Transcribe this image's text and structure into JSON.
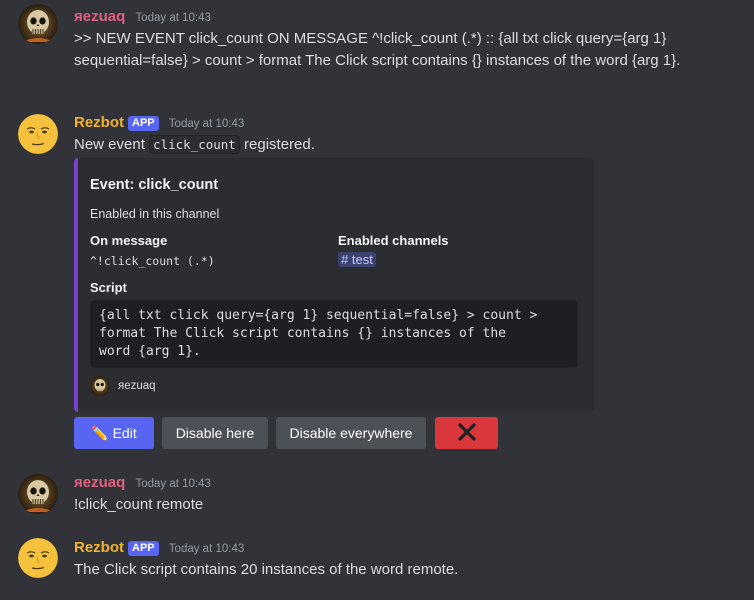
{
  "messages": [
    {
      "author": "яezuaq",
      "timestamp": "Today at 10:43",
      "text": ">> NEW EVENT click_count ON MESSAGE ^!click_count (.*) :: {all txt click query={arg 1} sequential=false} > count > format The Click script contains {} instances of the word {arg 1}."
    },
    {
      "author": "Rezbot",
      "app_tag": "APP",
      "timestamp": "Today at 10:43",
      "text_before": "New event ",
      "code": "click_count",
      "text_after": " registered.",
      "embed": {
        "title": "Event: click_count",
        "description": "Enabled in this channel",
        "field1_name": "On message",
        "field1_value": "^!click_count (.*)",
        "field2_name": "Enabled channels",
        "field2_channel_hash": "#",
        "field2_value": "test",
        "field3_name": "Script",
        "field3_code": "{all txt click query={arg 1} sequential=false} > count >\nformat The Click script contains {} instances of the\nword {arg 1}.",
        "footer": "яezuaq",
        "accent_color": "#7b3fd1"
      },
      "buttons": {
        "edit_emoji": "✏️",
        "edit_label": "Edit",
        "disable_here": "Disable here",
        "disable_everywhere": "Disable everywhere",
        "delete_icon": "close-icon"
      }
    },
    {
      "author": "яezuaq",
      "timestamp": "Today at 10:43",
      "text": "!click_count remote"
    },
    {
      "author": "Rezbot",
      "app_tag": "APP",
      "timestamp": "Today at 10:43",
      "text": "The Click script contains 20 instances of the word remote."
    }
  ],
  "colors": {
    "background": "#313338",
    "user_name": "#e0607e",
    "bot_name": "#f0b232",
    "app_tag": "#5865f2",
    "primary_button": "#5865f2",
    "secondary_button": "#4e5058",
    "danger_button": "#da373c"
  }
}
